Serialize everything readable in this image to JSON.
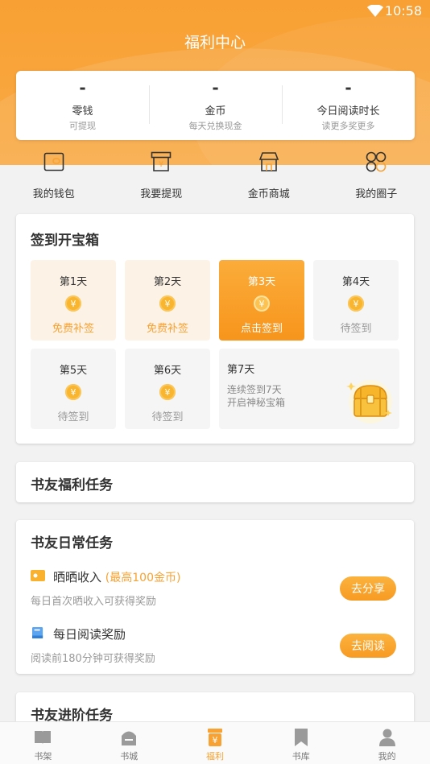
{
  "status_bar": {
    "time": "10:58"
  },
  "header": {
    "title": "福利中心"
  },
  "summary": [
    {
      "value": "-",
      "name": "零钱",
      "sub": "可提现"
    },
    {
      "value": "-",
      "name": "金币",
      "sub": "每天兑换现金"
    },
    {
      "value": "-",
      "name": "今日阅读时长",
      "sub": "读更多奖更多"
    }
  ],
  "quick_nav": [
    {
      "label": "我的钱包",
      "icon": "wallet-icon"
    },
    {
      "label": "我要提现",
      "icon": "withdraw-icon"
    },
    {
      "label": "金币商城",
      "icon": "store-icon"
    },
    {
      "label": "我的圈子",
      "icon": "circle-icon"
    }
  ],
  "checkin": {
    "title": "签到开宝箱",
    "coin_symbol": "¥",
    "days": [
      {
        "label": "第1天",
        "status": "免费补签",
        "state": "makeup"
      },
      {
        "label": "第2天",
        "status": "免费补签",
        "state": "makeup"
      },
      {
        "label": "第3天",
        "status": "点击签到",
        "state": "active"
      },
      {
        "label": "第4天",
        "status": "待签到",
        "state": "pending"
      },
      {
        "label": "第5天",
        "status": "待签到",
        "state": "pending"
      },
      {
        "label": "第6天",
        "status": "待签到",
        "state": "pending"
      }
    ],
    "day7": {
      "label": "第7天",
      "desc_line1": "连续签到7天",
      "desc_line2": "开启神秘宝箱"
    }
  },
  "welfare_tasks": {
    "title": "书友福利任务"
  },
  "daily_tasks": {
    "title": "书友日常任务",
    "items": [
      {
        "name": "晒晒收入",
        "extra": "(最高100金币)",
        "desc": "每日首次晒收入可获得奖励",
        "button": "去分享"
      },
      {
        "name": "每日阅读奖励",
        "extra": "",
        "desc": "阅读前180分钟可获得奖励",
        "button": "去阅读"
      }
    ]
  },
  "advanced_tasks": {
    "title": "书友进阶任务"
  },
  "tab_bar": {
    "tabs": [
      {
        "label": "书架",
        "active": false
      },
      {
        "label": "书城",
        "active": false
      },
      {
        "label": "福利",
        "active": true
      },
      {
        "label": "书库",
        "active": false
      },
      {
        "label": "我的",
        "active": false
      }
    ]
  },
  "colors": {
    "accent": "#f7a232",
    "header": "#f8a033"
  }
}
